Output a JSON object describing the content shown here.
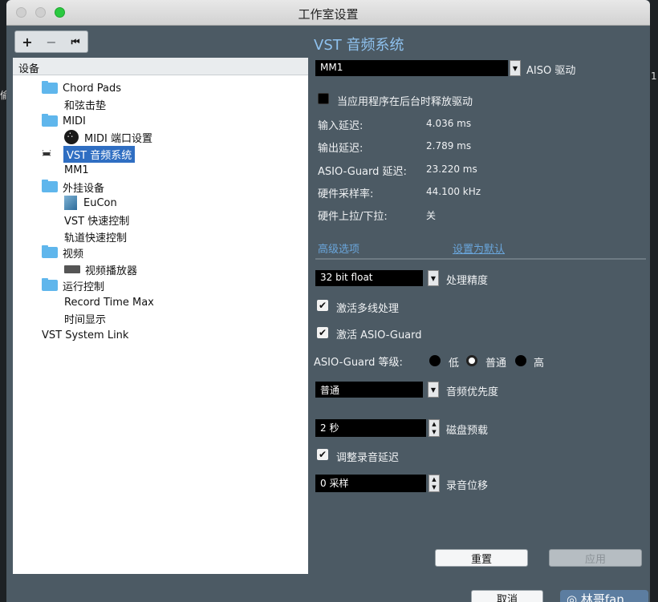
{
  "window": {
    "title": "工作室设置"
  },
  "background": {
    "left_fragment": "偷",
    "right_fragment": "1"
  },
  "toolbar": {
    "add_symbol": "+",
    "remove_symbol": "−",
    "reset_symbol": "⏮"
  },
  "tree": {
    "header": "设备",
    "items": [
      {
        "label": "Chord Pads",
        "icon": "folder-icon"
      },
      {
        "label": "和弦击垫",
        "icon": ""
      },
      {
        "label": "MIDI",
        "icon": "folder-icon"
      },
      {
        "label": "MIDI 端口设置",
        "icon": "midi-port-icon"
      },
      {
        "label": "VST 音频系统",
        "icon": "audio-system-icon",
        "selected": true
      },
      {
        "label": "MM1",
        "icon": ""
      },
      {
        "label": "外挂设备",
        "icon": "folder-icon"
      },
      {
        "label": "EuCon",
        "icon": "eucon-icon"
      },
      {
        "label": "VST 快速控制",
        "icon": ""
      },
      {
        "label": "轨道快速控制",
        "icon": ""
      },
      {
        "label": "视频",
        "icon": "folder-icon"
      },
      {
        "label": "视频播放器",
        "icon": "video-icon"
      },
      {
        "label": "运行控制",
        "icon": "folder-icon"
      },
      {
        "label": "Record Time Max",
        "icon": ""
      },
      {
        "label": "时间显示",
        "icon": ""
      },
      {
        "label": "VST System Link",
        "icon": ""
      }
    ]
  },
  "panel": {
    "title": "VST 音频系统",
    "driver_value": "MM1",
    "driver_label": "AISO 驱动",
    "release_driver_label": "当应用程序在后台时释放驱动",
    "input_latency_label": "输入延迟:",
    "input_latency_value": "4.036 ms",
    "output_latency_label": "输出延迟:",
    "output_latency_value": "2.789 ms",
    "asio_guard_latency_label": "ASIO-Guard 延迟:",
    "asio_guard_latency_value": "23.220 ms",
    "sample_rate_label": "硬件采样率:",
    "sample_rate_value": "44.100 kHz",
    "pull_label": "硬件上拉/下拉:",
    "pull_value": "关",
    "advanced_options": "高级选项",
    "set_default": "设置为默认",
    "precision_value": "32 bit float",
    "precision_label": "处理精度",
    "multiprocessing_label": "激活多线处理",
    "asio_guard_label": "激活 ASIO-Guard",
    "asio_guard_level_label": "ASIO-Guard 等级:",
    "level_low": "低",
    "level_normal": "普通",
    "level_high": "高",
    "priority_value": "普通",
    "priority_label": "音频优先度",
    "disk_value": "2 秒",
    "disk_label": "磁盘预载",
    "adjust_latency_label": "调整录音延迟",
    "offset_value": "0 采样",
    "offset_label": "录音位移",
    "reset_button": "重置",
    "apply_button": "应用"
  },
  "footer": {
    "cancel_button": "取消",
    "watermark": "◎ 林哥fan"
  }
}
